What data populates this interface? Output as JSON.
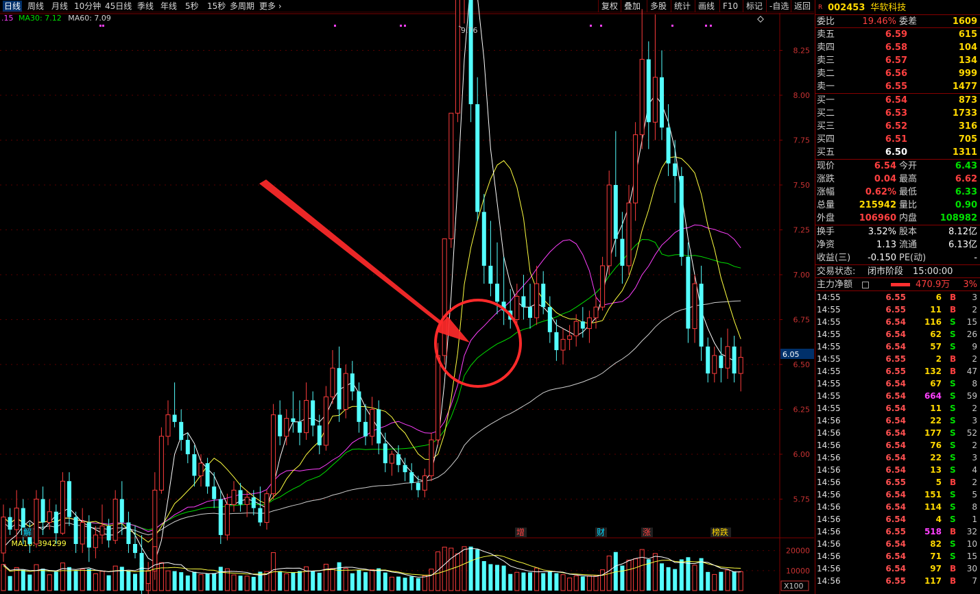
{
  "toolbar": {
    "periods": [
      "日线",
      "周线",
      "月线",
      "10分钟",
      "45日线",
      "季线",
      "年线",
      "5秒",
      "15秒",
      "多周期",
      "更多"
    ],
    "active_period": "日线",
    "tools": [
      "复权",
      "叠加",
      "多股",
      "统计",
      "画线",
      "F10",
      "标记",
      "-自选",
      "返回"
    ]
  },
  "main_legend": {
    "prefix": ".15",
    "ma30": "MA30: 7.12",
    "ma60": "MA60: 7.09"
  },
  "vol_legend": {
    "prefix": "6",
    "ma10": "MA10: 394299"
  },
  "peak_label": "9.76",
  "current_price_tag": "6.05",
  "vol_scale_label": "X100",
  "event_markers": [
    {
      "text": "解",
      "x": 38,
      "color": "#00d8ff"
    },
    {
      "text": "增",
      "x": 757,
      "color": "#ff4040"
    },
    {
      "text": "财",
      "x": 874,
      "color": "#00d8ff"
    },
    {
      "text": "涨",
      "x": 941,
      "color": "#ff4040"
    },
    {
      "text": "榜跌",
      "x": 1042,
      "color": "#ffd800"
    }
  ],
  "colors": {
    "up": "#ff3c3c",
    "down": "#54ffff",
    "ma5": "#ffffff",
    "ma10": "#ffff40",
    "ma20": "#ff40ff",
    "ma30": "#00e000",
    "ma60": "#d0d0d0",
    "axis": "#800000"
  },
  "chart_data": {
    "type": "candlestick",
    "y_ticks": [
      4.5,
      4.75,
      5.0,
      5.25,
      5.5,
      5.75,
      6.0,
      6.25,
      6.5,
      6.75,
      7.0,
      7.25,
      7.5,
      7.75,
      8.0,
      8.25,
      8.5,
      8.75,
      9.0,
      9.25,
      9.5
    ],
    "y_range": [
      4.27,
      9.78
    ],
    "vol_ticks": [
      10000,
      20000
    ],
    "vol_max": 24000,
    "candles_ohlc": [
      [
        5.45,
        5.72,
        5.4,
        5.65
      ],
      [
        5.65,
        5.7,
        5.55,
        5.58
      ],
      [
        5.58,
        5.8,
        5.52,
        5.7
      ],
      [
        5.7,
        5.75,
        5.5,
        5.55
      ],
      [
        5.55,
        5.62,
        5.45,
        5.5
      ],
      [
        5.5,
        5.8,
        5.48,
        5.75
      ],
      [
        5.75,
        5.82,
        5.55,
        5.62
      ],
      [
        5.62,
        5.75,
        5.58,
        5.68
      ],
      [
        5.68,
        5.72,
        5.5,
        5.56
      ],
      [
        5.56,
        5.9,
        5.55,
        5.85
      ],
      [
        5.85,
        5.9,
        5.6,
        5.65
      ],
      [
        5.65,
        5.68,
        5.45,
        5.5
      ],
      [
        5.5,
        5.7,
        5.45,
        5.62
      ],
      [
        5.62,
        5.66,
        5.4,
        5.48
      ],
      [
        5.48,
        5.6,
        5.42,
        5.55
      ],
      [
        5.55,
        5.72,
        5.5,
        5.6
      ],
      [
        5.6,
        5.64,
        5.48,
        5.52
      ],
      [
        5.52,
        5.8,
        5.5,
        5.75
      ],
      [
        5.75,
        5.85,
        5.55,
        5.62
      ],
      [
        5.62,
        5.68,
        5.45,
        5.5
      ],
      [
        5.5,
        5.6,
        5.42,
        5.45
      ],
      [
        5.45,
        5.55,
        5.2,
        5.28
      ],
      [
        5.28,
        5.4,
        5.18,
        5.35
      ],
      [
        5.35,
        5.9,
        5.3,
        5.8
      ],
      [
        5.8,
        6.15,
        5.78,
        6.1
      ],
      [
        6.1,
        6.3,
        6.05,
        6.22
      ],
      [
        6.22,
        6.4,
        6.15,
        6.18
      ],
      [
        6.18,
        6.25,
        6.02,
        6.08
      ],
      [
        6.08,
        6.12,
        5.95,
        6.0
      ],
      [
        6.0,
        6.05,
        5.82,
        5.88
      ],
      [
        5.88,
        6.0,
        5.82,
        5.95
      ],
      [
        5.95,
        5.98,
        5.78,
        5.82
      ],
      [
        5.82,
        5.9,
        5.7,
        5.75
      ],
      [
        5.75,
        5.8,
        5.5,
        5.55
      ],
      [
        5.55,
        5.78,
        5.52,
        5.72
      ],
      [
        5.72,
        5.85,
        5.68,
        5.8
      ],
      [
        5.8,
        5.84,
        5.68,
        5.72
      ],
      [
        5.72,
        5.8,
        5.65,
        5.76
      ],
      [
        5.76,
        5.8,
        5.66,
        5.7
      ],
      [
        5.7,
        5.82,
        5.6,
        5.62
      ],
      [
        5.62,
        5.8,
        5.58,
        5.78
      ],
      [
        5.78,
        6.28,
        5.75,
        6.22
      ],
      [
        6.22,
        6.3,
        6.05,
        6.1
      ],
      [
        6.1,
        6.25,
        6.05,
        6.2
      ],
      [
        6.2,
        6.35,
        6.12,
        6.18
      ],
      [
        6.18,
        6.3,
        6.05,
        6.12
      ],
      [
        6.12,
        6.4,
        6.08,
        6.3
      ],
      [
        6.3,
        6.35,
        6.1,
        6.16
      ],
      [
        6.16,
        6.22,
        6.0,
        6.05
      ],
      [
        6.05,
        6.38,
        6.02,
        6.32
      ],
      [
        6.32,
        6.58,
        6.28,
        6.48
      ],
      [
        6.48,
        6.6,
        6.18,
        6.25
      ],
      [
        6.25,
        6.5,
        6.2,
        6.45
      ],
      [
        6.45,
        6.52,
        6.3,
        6.35
      ],
      [
        6.35,
        6.4,
        6.12,
        6.18
      ],
      [
        6.18,
        6.28,
        6.05,
        6.1
      ],
      [
        6.1,
        6.32,
        6.05,
        6.25
      ],
      [
        6.25,
        6.3,
        6.0,
        6.06
      ],
      [
        6.06,
        6.12,
        5.9,
        5.95
      ],
      [
        5.95,
        6.02,
        5.88,
        6.0
      ],
      [
        6.0,
        6.05,
        5.9,
        5.94
      ],
      [
        5.94,
        5.98,
        5.85,
        5.9
      ],
      [
        5.9,
        5.95,
        5.8,
        5.84
      ],
      [
        5.84,
        5.88,
        5.76,
        5.8
      ],
      [
        5.8,
        5.92,
        5.76,
        5.88
      ],
      [
        5.88,
        6.12,
        5.85,
        6.08
      ],
      [
        6.08,
        6.62,
        6.05,
        6.55
      ],
      [
        6.55,
        7.2,
        6.5,
        7.2
      ],
      [
        7.2,
        7.9,
        7.15,
        7.9
      ],
      [
        7.9,
        8.55,
        7.85,
        8.55
      ],
      [
        8.55,
        9.65,
        8.4,
        9.76
      ],
      [
        8.8,
        8.95,
        7.85,
        7.95
      ],
      [
        7.95,
        8.1,
        7.3,
        7.35
      ],
      [
        7.35,
        7.45,
        6.95,
        7.05
      ],
      [
        7.05,
        7.3,
        6.88,
        6.95
      ],
      [
        6.95,
        7.18,
        6.78,
        6.85
      ],
      [
        6.85,
        7.1,
        6.72,
        6.8
      ],
      [
        6.8,
        6.92,
        6.7,
        6.75
      ],
      [
        6.75,
        6.95,
        6.7,
        6.88
      ],
      [
        6.88,
        7.0,
        6.75,
        6.82
      ],
      [
        6.82,
        6.95,
        6.7,
        6.76
      ],
      [
        6.76,
        7.05,
        6.72,
        6.95
      ],
      [
        6.95,
        7.02,
        6.78,
        6.82
      ],
      [
        6.82,
        6.88,
        6.62,
        6.68
      ],
      [
        6.68,
        6.75,
        6.52,
        6.58
      ],
      [
        6.58,
        6.7,
        6.5,
        6.64
      ],
      [
        6.64,
        6.72,
        6.58,
        6.66
      ],
      [
        6.66,
        6.78,
        6.6,
        6.74
      ],
      [
        6.74,
        6.82,
        6.65,
        6.7
      ],
      [
        6.7,
        6.8,
        6.62,
        6.76
      ],
      [
        6.76,
        6.88,
        6.7,
        6.82
      ],
      [
        6.82,
        7.1,
        6.8,
        7.05
      ],
      [
        7.05,
        7.58,
        7.0,
        7.5
      ],
      [
        7.5,
        7.8,
        7.1,
        7.2
      ],
      [
        7.2,
        7.35,
        6.95,
        7.05
      ],
      [
        7.05,
        7.5,
        7.0,
        7.4
      ],
      [
        7.4,
        7.85,
        7.3,
        7.78
      ],
      [
        7.78,
        8.48,
        7.7,
        8.2
      ],
      [
        8.2,
        8.3,
        7.7,
        7.85
      ],
      [
        7.85,
        8.45,
        7.75,
        8.1
      ],
      [
        8.1,
        8.25,
        7.75,
        7.82
      ],
      [
        7.82,
        7.95,
        7.55,
        7.62
      ],
      [
        7.62,
        7.75,
        7.4,
        7.55
      ],
      [
        7.55,
        7.6,
        7.05,
        7.1
      ],
      [
        7.1,
        7.18,
        6.62,
        6.7
      ],
      [
        6.7,
        7.0,
        6.62,
        6.95
      ],
      [
        6.95,
        7.05,
        6.52,
        6.6
      ],
      [
        6.6,
        6.65,
        6.4,
        6.45
      ],
      [
        6.45,
        6.6,
        6.4,
        6.55
      ],
      [
        6.55,
        6.65,
        6.4,
        6.48
      ],
      [
        6.48,
        6.7,
        6.42,
        6.6
      ],
      [
        6.6,
        6.66,
        6.4,
        6.45
      ],
      [
        6.45,
        6.6,
        6.35,
        6.54
      ]
    ],
    "ma5": [
      5.48,
      5.52,
      5.55,
      5.6,
      5.63,
      5.6,
      5.58,
      5.62,
      5.66,
      5.68,
      5.7,
      5.66,
      5.62,
      5.6,
      5.58,
      5.56,
      5.55,
      5.55,
      5.58,
      5.6,
      5.55,
      5.48,
      5.42,
      5.4,
      5.52,
      5.75,
      6.0,
      6.1,
      6.12,
      6.06,
      5.96,
      5.92,
      5.88,
      5.8,
      5.72,
      5.72,
      5.74,
      5.75,
      5.74,
      5.72,
      5.7,
      5.82,
      5.98,
      6.1,
      6.18,
      6.18,
      6.2,
      6.2,
      6.18,
      6.22,
      6.3,
      6.36,
      6.38,
      6.4,
      6.34,
      6.26,
      6.2,
      6.14,
      6.08,
      6.04,
      6.0,
      5.94,
      5.9,
      5.86,
      5.85,
      5.9,
      6.06,
      6.4,
      6.88,
      7.5,
      8.2,
      8.64,
      8.55,
      8.2,
      7.7,
      7.4,
      7.1,
      6.95,
      6.85,
      6.82,
      6.82,
      6.84,
      6.82,
      6.78,
      6.72,
      6.7,
      6.68,
      6.66,
      6.68,
      6.72,
      6.76,
      6.88,
      7.08,
      7.2,
      7.28,
      7.38,
      7.55,
      7.75,
      7.95,
      8.0,
      7.95,
      7.85,
      7.7,
      7.45,
      7.2,
      7.0,
      6.8,
      6.7,
      6.62,
      6.56,
      6.54,
      6.52
    ]
  },
  "panel": {
    "code": "002453",
    "name": "华软科技",
    "flag": "R",
    "weibi_label": "委比",
    "weibi": "19.46%",
    "weicha_label": "委差",
    "weicha": "1609",
    "asks": [
      {
        "label": "卖五",
        "price": "6.59",
        "qty": "615"
      },
      {
        "label": "卖四",
        "price": "6.58",
        "qty": "104"
      },
      {
        "label": "卖三",
        "price": "6.57",
        "qty": "134"
      },
      {
        "label": "卖二",
        "price": "6.56",
        "qty": "999"
      },
      {
        "label": "卖一",
        "price": "6.55",
        "qty": "1477"
      }
    ],
    "bids": [
      {
        "label": "买一",
        "price": "6.54",
        "qty": "873"
      },
      {
        "label": "买二",
        "price": "6.53",
        "qty": "1733"
      },
      {
        "label": "买三",
        "price": "6.52",
        "qty": "316"
      },
      {
        "label": "买四",
        "price": "6.51",
        "qty": "705"
      },
      {
        "label": "买五",
        "price": "6.50",
        "qty": "1311"
      }
    ],
    "quote": [
      {
        "l": "现价",
        "v": "6.54",
        "vc": "red",
        "l2": "今开",
        "v2": "6.43",
        "v2c": "green"
      },
      {
        "l": "涨跌",
        "v": "0.04",
        "vc": "red",
        "l2": "最高",
        "v2": "6.62",
        "v2c": "red"
      },
      {
        "l": "涨幅",
        "v": "0.62%",
        "vc": "red",
        "l2": "最低",
        "v2": "6.33",
        "v2c": "green"
      },
      {
        "l": "总量",
        "v": "215942",
        "vc": "yellow",
        "l2": "量比",
        "v2": "0.90",
        "v2c": "green"
      },
      {
        "l": "外盘",
        "v": "106960",
        "vc": "red",
        "l2": "内盘",
        "v2": "108982",
        "v2c": "green"
      }
    ],
    "fund": [
      {
        "l": "换手",
        "v": "3.52%",
        "l2": "股本",
        "v2": "8.12亿"
      },
      {
        "l": "净资",
        "v": "1.13",
        "l2": "流通",
        "v2": "6.13亿"
      },
      {
        "l": "收益(三)",
        "v": "-0.150",
        "l2": "PE(动)",
        "v2": "-"
      }
    ],
    "status_label": "交易状态:",
    "status_value": "闭市阶段",
    "status_time": "15:00:00",
    "main_force_label": "主力净额",
    "main_force_value": "470.9万",
    "main_force_pct": "3%",
    "trades": [
      [
        "14:55",
        "6.55",
        "6",
        "B",
        "3"
      ],
      [
        "14:55",
        "6.55",
        "11",
        "B",
        "2"
      ],
      [
        "14:55",
        "6.54",
        "116",
        "S",
        "15"
      ],
      [
        "14:55",
        "6.54",
        "62",
        "S",
        "26"
      ],
      [
        "14:55",
        "6.54",
        "57",
        "S",
        "9"
      ],
      [
        "14:55",
        "6.55",
        "2",
        "B",
        "2"
      ],
      [
        "14:55",
        "6.55",
        "132",
        "B",
        "47"
      ],
      [
        "14:55",
        "6.54",
        "67",
        "S",
        "8"
      ],
      [
        "14:55",
        "6.54",
        "664",
        "S",
        "59"
      ],
      [
        "14:55",
        "6.54",
        "11",
        "S",
        "2"
      ],
      [
        "14:56",
        "6.54",
        "22",
        "S",
        "3"
      ],
      [
        "14:56",
        "6.54",
        "177",
        "S",
        "52"
      ],
      [
        "14:56",
        "6.54",
        "76",
        "S",
        "2"
      ],
      [
        "14:56",
        "6.54",
        "22",
        "S",
        "3"
      ],
      [
        "14:56",
        "6.54",
        "13",
        "S",
        "4"
      ],
      [
        "14:56",
        "6.55",
        "5",
        "B",
        "2"
      ],
      [
        "14:56",
        "6.54",
        "151",
        "S",
        "5"
      ],
      [
        "14:56",
        "6.54",
        "114",
        "S",
        "8"
      ],
      [
        "14:56",
        "6.54",
        "4",
        "S",
        "1"
      ],
      [
        "14:56",
        "6.55",
        "518",
        "B",
        "32"
      ],
      [
        "14:56",
        "6.54",
        "82",
        "S",
        "10"
      ],
      [
        "14:56",
        "6.54",
        "71",
        "S",
        "15"
      ],
      [
        "14:56",
        "6.54",
        "97",
        "B",
        "30"
      ],
      [
        "14:56",
        "6.55",
        "117",
        "B",
        "7"
      ]
    ]
  }
}
